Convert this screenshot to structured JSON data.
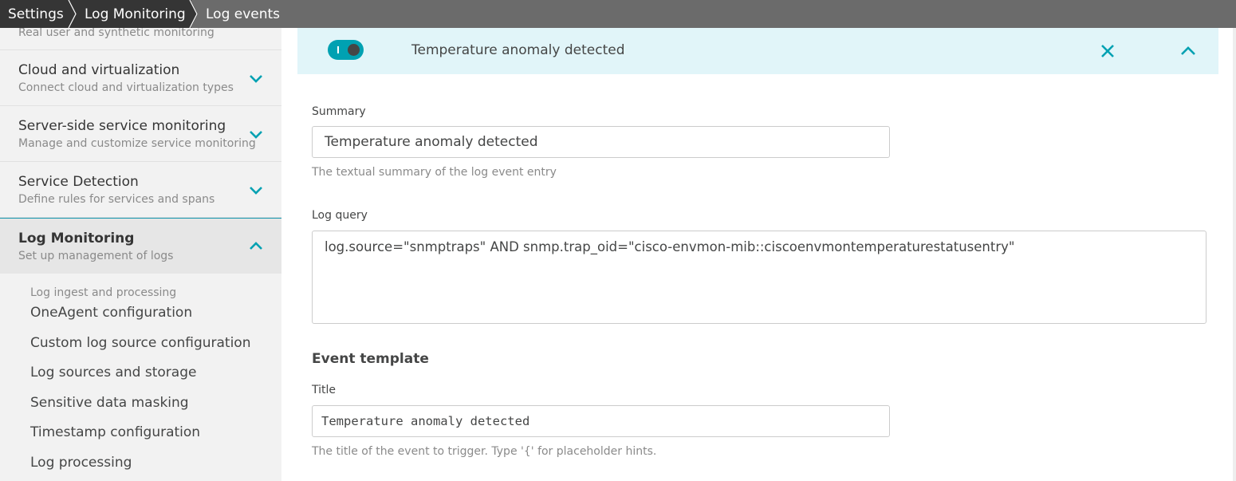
{
  "breadcrumb": [
    {
      "label": "Settings"
    },
    {
      "label": "Log Monitoring"
    },
    {
      "label": "Log events"
    }
  ],
  "sidebar": {
    "cut_off_description": "Real user and synthetic monitoring",
    "groups": [
      {
        "title": "Cloud and virtualization",
        "description": "Connect cloud and virtualization types",
        "expanded": false,
        "icon": "chevron-down-icon"
      },
      {
        "title": "Server-side service monitoring",
        "description": "Manage and customize service monitoring",
        "expanded": false,
        "icon": "chevron-down-icon"
      },
      {
        "title": "Service Detection",
        "description": "Define rules for services and spans",
        "expanded": false,
        "icon": "chevron-down-icon"
      },
      {
        "title": "Log Monitoring",
        "description": "Set up management of logs",
        "expanded": true,
        "icon": "chevron-up-icon"
      }
    ],
    "subsection": {
      "heading": "Log ingest and processing",
      "items": [
        {
          "label": "OneAgent configuration"
        },
        {
          "label": "Custom log source configuration"
        },
        {
          "label": "Log sources and storage"
        },
        {
          "label": "Sensitive data masking"
        },
        {
          "label": "Timestamp configuration"
        },
        {
          "label": "Log processing"
        }
      ]
    }
  },
  "rule": {
    "enabled": true,
    "title": "Temperature anomaly detected",
    "close_icon": "close-icon",
    "collapse_icon": "chevron-up-icon"
  },
  "form": {
    "summary": {
      "label": "Summary",
      "value": "Temperature anomaly detected",
      "hint": "The textual summary of the log event entry"
    },
    "log_query": {
      "label": "Log query",
      "value": "log.source=\"snmptraps\" AND snmp.trap_oid=\"cisco-envmon-mib::ciscoenvmontemperaturestatusentry\""
    },
    "event_template": {
      "section_title": "Event template",
      "title_field": {
        "label": "Title",
        "value": "Temperature anomaly detected",
        "hint": "The title of the event to trigger. Type '{' for placeholder hints."
      }
    }
  },
  "colors": {
    "accent": "#00a1b2",
    "header_bg": "#e1f5f9",
    "topbar_bg": "#6b6b6b",
    "crumb_dark": "#353535",
    "sidebar_bg": "#f2f2f2"
  }
}
